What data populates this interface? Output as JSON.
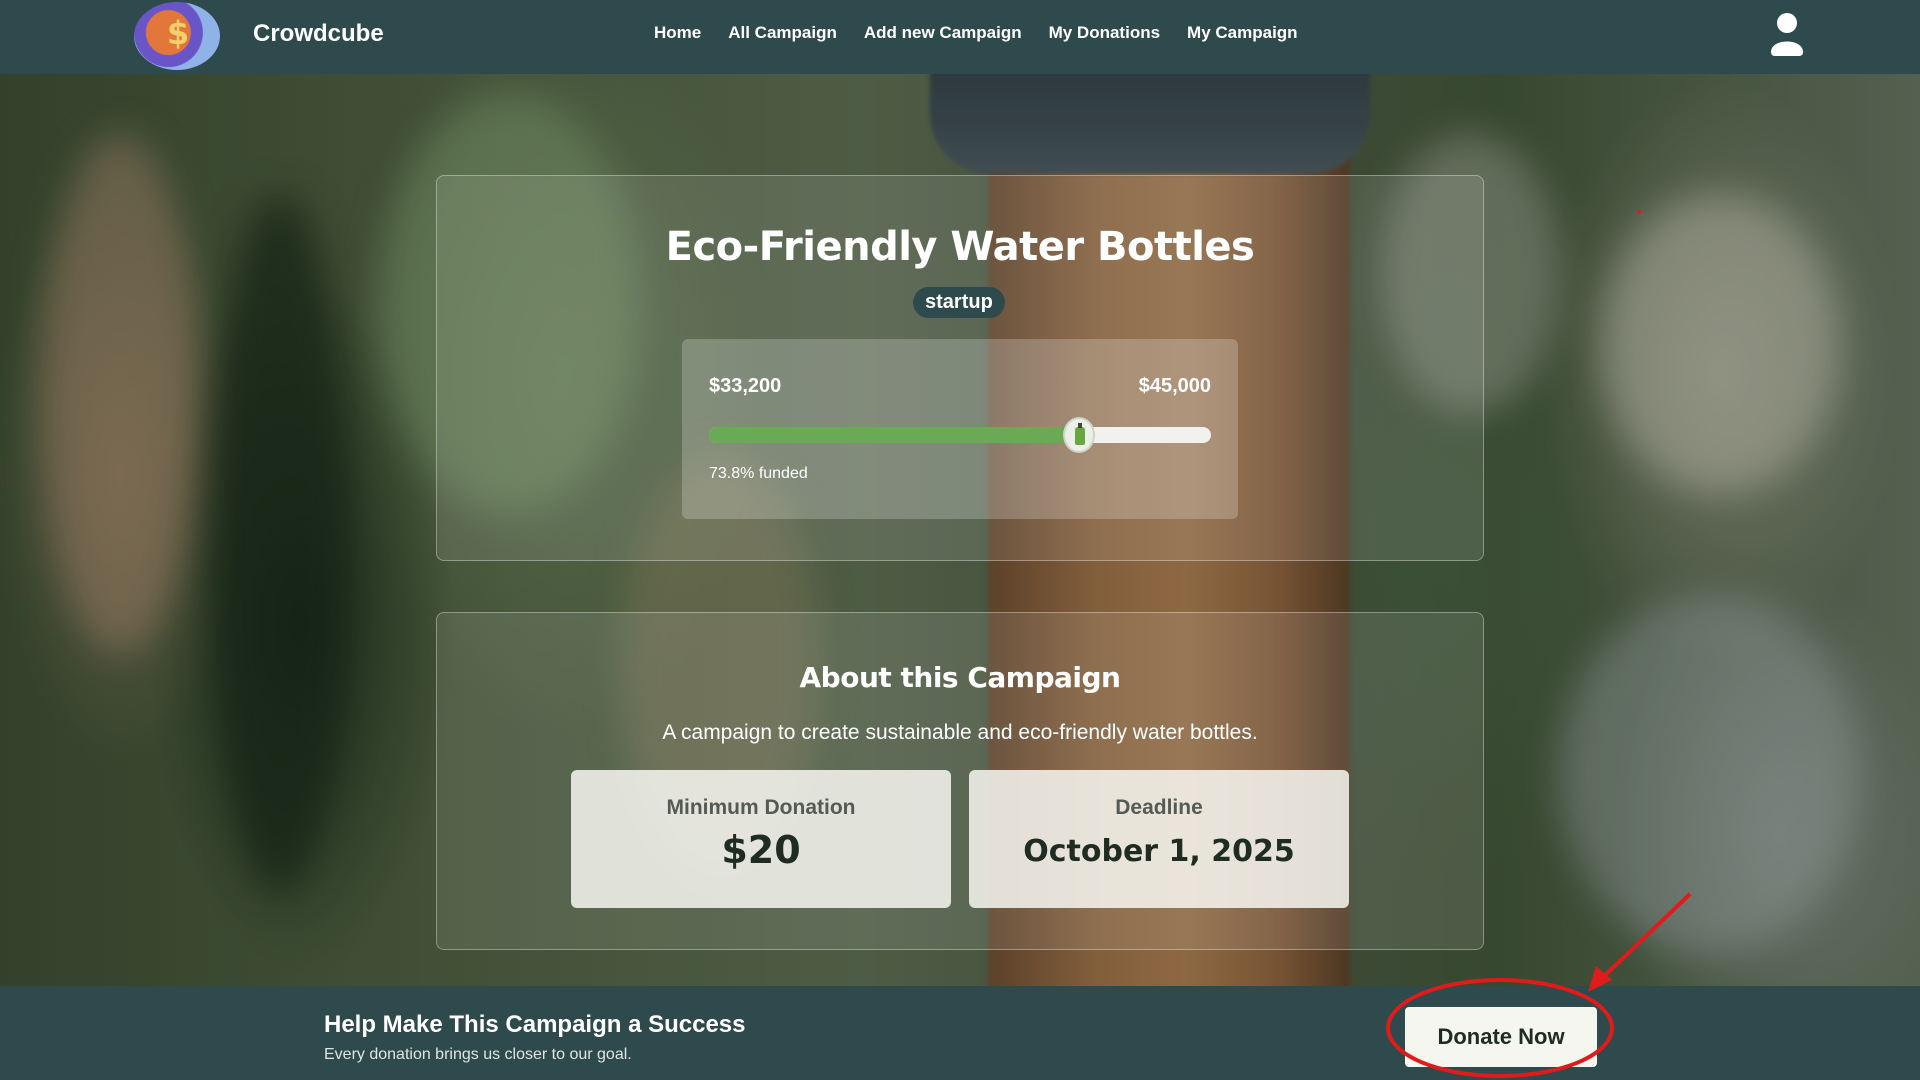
{
  "nav": {
    "brand": "Crowdcube",
    "links": [
      "Home",
      "All Campaign",
      "Add new Campaign",
      "My Donations",
      "My Campaign"
    ],
    "logo_symbol": "$",
    "user_icon": "user-icon"
  },
  "campaign": {
    "title": "Eco-Friendly Water Bottles",
    "category": "startup",
    "raised": "$33,200",
    "goal": "$45,000",
    "funded_fraction": 0.738,
    "funded_text": "73.8% funded",
    "slider_icon": "bottle-icon"
  },
  "about": {
    "title": "About this Campaign",
    "description": "A campaign to create sustainable and eco-friendly water bottles.",
    "min_donation_label": "Minimum Donation",
    "min_donation_value": "$20",
    "deadline_label": "Deadline",
    "deadline_value": "October 1, 2025"
  },
  "cta": {
    "title": "Help Make This Campaign a Success",
    "subtitle": "Every donation brings us closer to our goal.",
    "button": "Donate Now"
  },
  "colors": {
    "nav_bg": "#2f4a4c",
    "progress_fill": "#6aaa55",
    "annotation": "#e01b1b"
  }
}
